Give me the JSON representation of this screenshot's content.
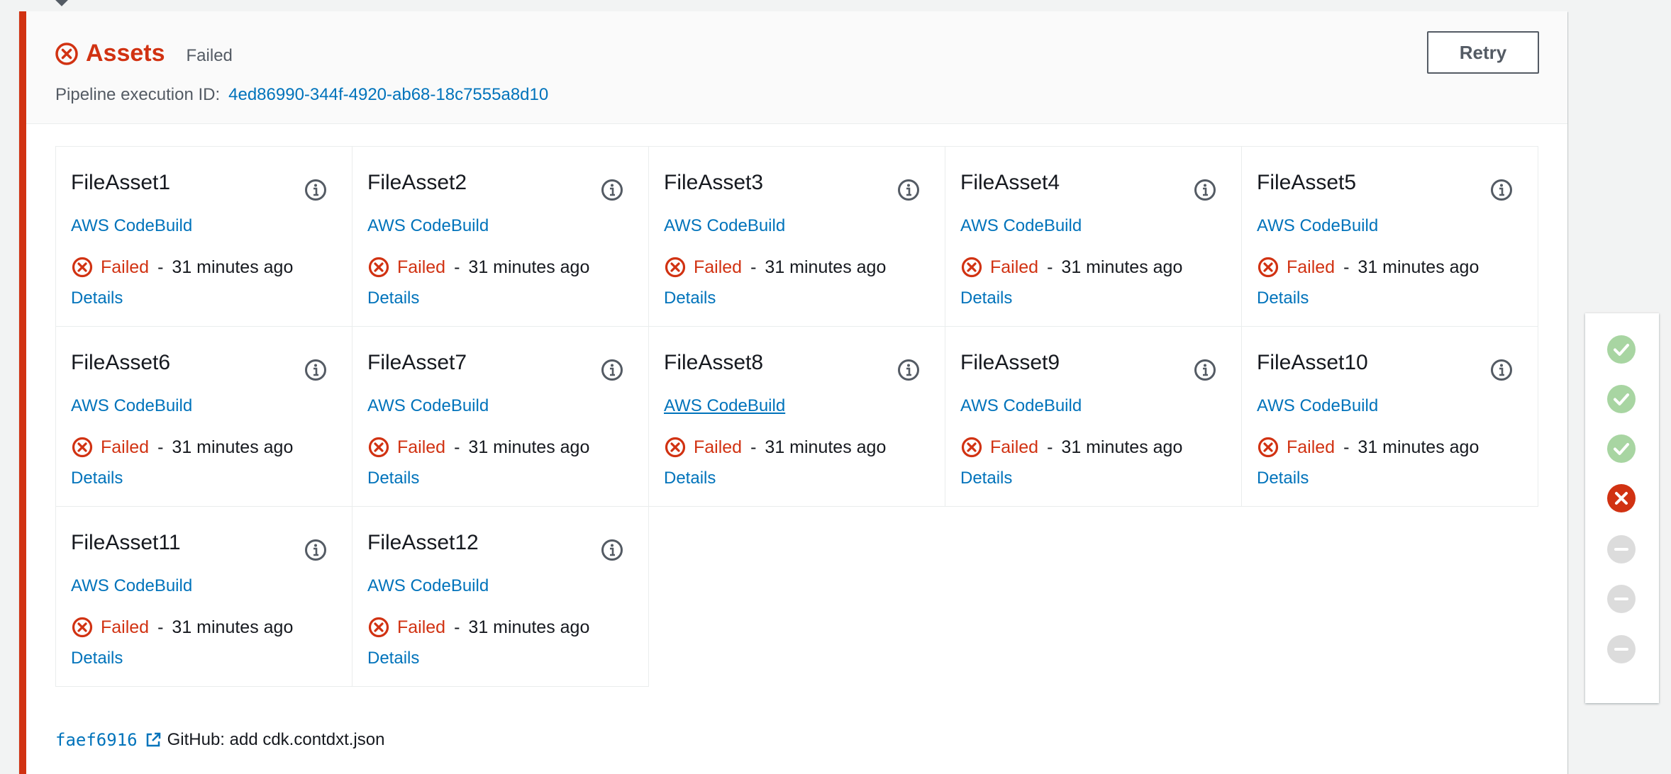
{
  "stage": {
    "title": "Assets",
    "status": "Failed",
    "execution_label": "Pipeline execution ID:",
    "execution_id": "4ed86990-344f-4920-ab68-18c7555a8d10",
    "retry_label": "Retry"
  },
  "actions": [
    {
      "name": "FileAsset1",
      "provider": "AWS CodeBuild",
      "status": "Failed",
      "time": "31 minutes ago",
      "details": "Details"
    },
    {
      "name": "FileAsset2",
      "provider": "AWS CodeBuild",
      "status": "Failed",
      "time": "31 minutes ago",
      "details": "Details"
    },
    {
      "name": "FileAsset3",
      "provider": "AWS CodeBuild",
      "status": "Failed",
      "time": "31 minutes ago",
      "details": "Details"
    },
    {
      "name": "FileAsset4",
      "provider": "AWS CodeBuild",
      "status": "Failed",
      "time": "31 minutes ago",
      "details": "Details"
    },
    {
      "name": "FileAsset5",
      "provider": "AWS CodeBuild",
      "status": "Failed",
      "time": "31 minutes ago",
      "details": "Details"
    },
    {
      "name": "FileAsset6",
      "provider": "AWS CodeBuild",
      "status": "Failed",
      "time": "31 minutes ago",
      "details": "Details"
    },
    {
      "name": "FileAsset7",
      "provider": "AWS CodeBuild",
      "status": "Failed",
      "time": "31 minutes ago",
      "details": "Details"
    },
    {
      "name": "FileAsset8",
      "provider": "AWS CodeBuild",
      "status": "Failed",
      "time": "31 minutes ago",
      "details": "Details",
      "hover": true
    },
    {
      "name": "FileAsset9",
      "provider": "AWS CodeBuild",
      "status": "Failed",
      "time": "31 minutes ago",
      "details": "Details"
    },
    {
      "name": "FileAsset10",
      "provider": "AWS CodeBuild",
      "status": "Failed",
      "time": "31 minutes ago",
      "details": "Details"
    },
    {
      "name": "FileAsset11",
      "provider": "AWS CodeBuild",
      "status": "Failed",
      "time": "31 minutes ago",
      "details": "Details"
    },
    {
      "name": "FileAsset12",
      "provider": "AWS CodeBuild",
      "status": "Failed",
      "time": "31 minutes ago",
      "details": "Details"
    }
  ],
  "commit": {
    "id": "faef6916",
    "message": "GitHub: add cdk.contdxt.json"
  },
  "side_status": [
    "succeeded",
    "succeeded",
    "succeeded",
    "failed",
    "not-run",
    "not-run",
    "not-run"
  ],
  "colors": {
    "failed": "#d13212",
    "link": "#0073bb",
    "succeeded": "#a8d5a2",
    "not_run": "#dcdcdc"
  }
}
